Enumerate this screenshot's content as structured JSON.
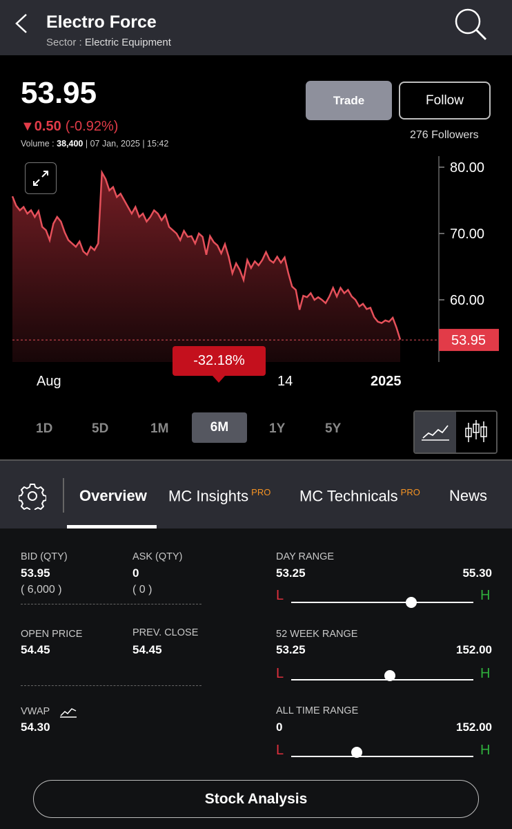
{
  "header": {
    "title": "Electro Force",
    "sector_label": "Sector :",
    "sector_value": "Electric Equipment"
  },
  "quote": {
    "price": "53.95",
    "change_arrow": "▼",
    "change": "0.50",
    "change_pct": "(-0.92%)",
    "volume_label": "Volume :",
    "volume_value": "38,400",
    "datetime": "| 07 Jan, 2025 | 15:42"
  },
  "actions": {
    "trade_label": "Trade",
    "follow_label": "Follow",
    "followers": "276 Followers"
  },
  "colors": {
    "accent_red": "#e23b48",
    "tooltip_red": "#c4101d",
    "pro_orange": "#f59323",
    "high_green": "#2fae3c"
  },
  "chart_data": {
    "type": "area",
    "x_tick_labels": [
      "Aug",
      "14",
      "2025"
    ],
    "y_tick_labels": [
      "80.00",
      "70.00",
      "60.00"
    ],
    "ylim": [
      52,
      82
    ],
    "last_price_label": "53.95",
    "change_tooltip": "-32.18%",
    "series": [
      {
        "values": [
          75.6,
          74.2,
          73.5,
          74.0,
          73.0,
          73.5,
          72.5,
          73.4,
          71.0,
          70.5,
          69.0,
          71.5,
          72.5,
          71.8,
          70.2,
          69.0,
          68.5,
          68.0,
          68.8,
          67.3,
          66.8,
          68.0,
          67.5,
          68.5,
          79.2,
          78.2,
          76.5,
          77.0,
          75.5,
          76.0,
          75.0,
          74.0,
          73.0,
          74.0,
          72.5,
          73.0,
          71.8,
          72.5,
          73.5,
          73.0,
          72.0,
          72.8,
          71.0,
          70.5,
          70.0,
          69.0,
          70.4,
          69.5,
          69.6,
          68.5,
          70.0,
          69.5,
          66.8,
          69.6,
          68.7,
          68.2,
          67.0,
          68.4,
          66.5,
          64.0,
          65.5,
          64.5,
          63.0,
          66.0,
          64.8,
          65.8,
          65.2,
          66.0,
          67.2,
          66.0,
          65.6,
          66.5,
          65.6,
          66.4,
          64.0,
          62.0,
          61.5,
          58.5,
          60.6,
          60.4,
          61.0,
          60.0,
          60.4,
          60.0,
          59.5,
          60.5,
          61.8,
          60.5,
          61.8,
          61.0,
          61.5,
          60.5,
          60.0,
          59.0,
          59.4,
          58.6,
          58.8,
          57.4,
          56.7,
          56.5,
          56.9,
          56.7,
          57.3,
          55.8,
          54.0
        ]
      }
    ]
  },
  "periods": [
    "1D",
    "5D",
    "1M",
    "6M",
    "1Y",
    "5Y"
  ],
  "active_period": "6M",
  "tabs": {
    "overview": "Overview",
    "insights": "MC Insights",
    "technicals": "MC Technicals",
    "news": "News",
    "pro_badge": "PRO"
  },
  "stats": {
    "bid_label": "BID (QTY)",
    "bid_value": "53.95",
    "bid_qty": "( 6,000 )",
    "ask_label": "ASK (QTY)",
    "ask_value": "0",
    "ask_qty": "( 0 )",
    "open_label": "OPEN PRICE",
    "open_value": "54.45",
    "prev_label": "PREV. CLOSE",
    "prev_value": "54.45",
    "vwap_label": "VWAP",
    "vwap_value": "54.30",
    "low_marker": "L",
    "high_marker": "H",
    "day_label": "DAY RANGE",
    "day_low": "53.25",
    "day_high": "55.30",
    "day_pos": 0.66,
    "week52_label": "52 WEEK RANGE",
    "week52_low": "53.25",
    "week52_high": "152.00",
    "week52_pos": 0.54,
    "all_label": "ALL TIME RANGE",
    "all_low": "0",
    "all_high": "152.00",
    "all_pos": 0.36
  },
  "analysis_label": "Stock Analysis"
}
